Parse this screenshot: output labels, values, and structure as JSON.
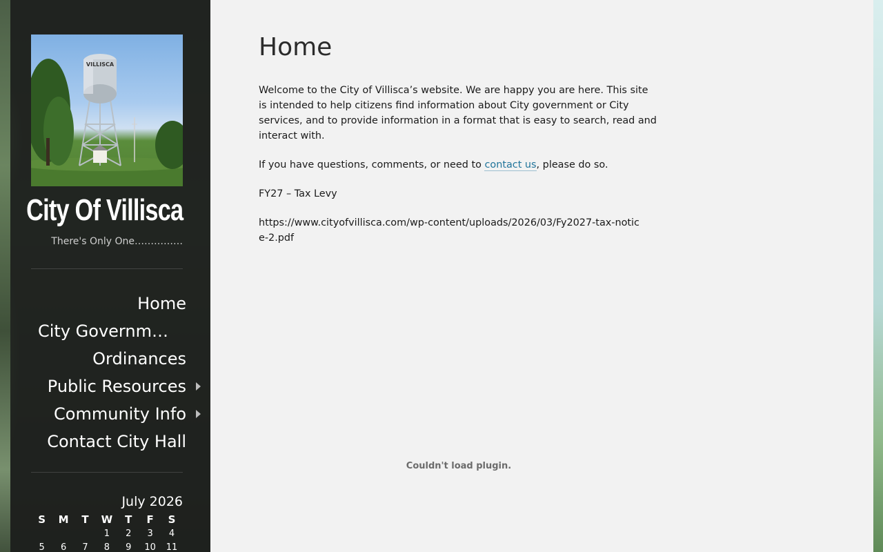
{
  "site": {
    "title": "City Of Villisca",
    "tagline": "There's Only One……………"
  },
  "header_image": {
    "tank_text": "VILLISCA"
  },
  "nav": {
    "items": [
      {
        "label": "Home",
        "has_submenu": false
      },
      {
        "label": "City Governm…",
        "has_submenu": false
      },
      {
        "label": "Ordinances",
        "has_submenu": false
      },
      {
        "label": "Public Resources",
        "has_submenu": true
      },
      {
        "label": "Community Info",
        "has_submenu": true
      },
      {
        "label": "Contact City Hall",
        "has_submenu": false
      }
    ],
    "submenu_icon": "triangle-right-icon"
  },
  "calendar": {
    "caption": "July 2026",
    "weekdays": [
      "S",
      "M",
      "T",
      "W",
      "T",
      "F",
      "S"
    ],
    "rows": [
      [
        "",
        "",
        "",
        "1",
        "2",
        "3",
        "4"
      ],
      [
        "5",
        "6",
        "7",
        "8",
        "9",
        "10",
        "11"
      ]
    ]
  },
  "page": {
    "title": "Home",
    "paragraph1": "Welcome to the City of Villisca’s website. We are happy you are here. This site is intended to help citizens find information about City government or City services, and to provide information in a format that is easy to search, read and interact with.",
    "paragraph2_before": "If you have questions, comments, or need to ",
    "paragraph2_link": "contact us",
    "paragraph2_after": ", please do so.",
    "fy_label": "FY27 – Tax Levy",
    "pdf_url": "https://www.cityofvillisca.com/wp-content/uploads/2026/03/Fy2027-tax-notice-2.pdf",
    "plugin_message": "Couldn't load plugin."
  },
  "colors": {
    "link": "#21759b",
    "content_bg": "#f2f2f2",
    "sidebar_bg": "#1c1e1c"
  }
}
